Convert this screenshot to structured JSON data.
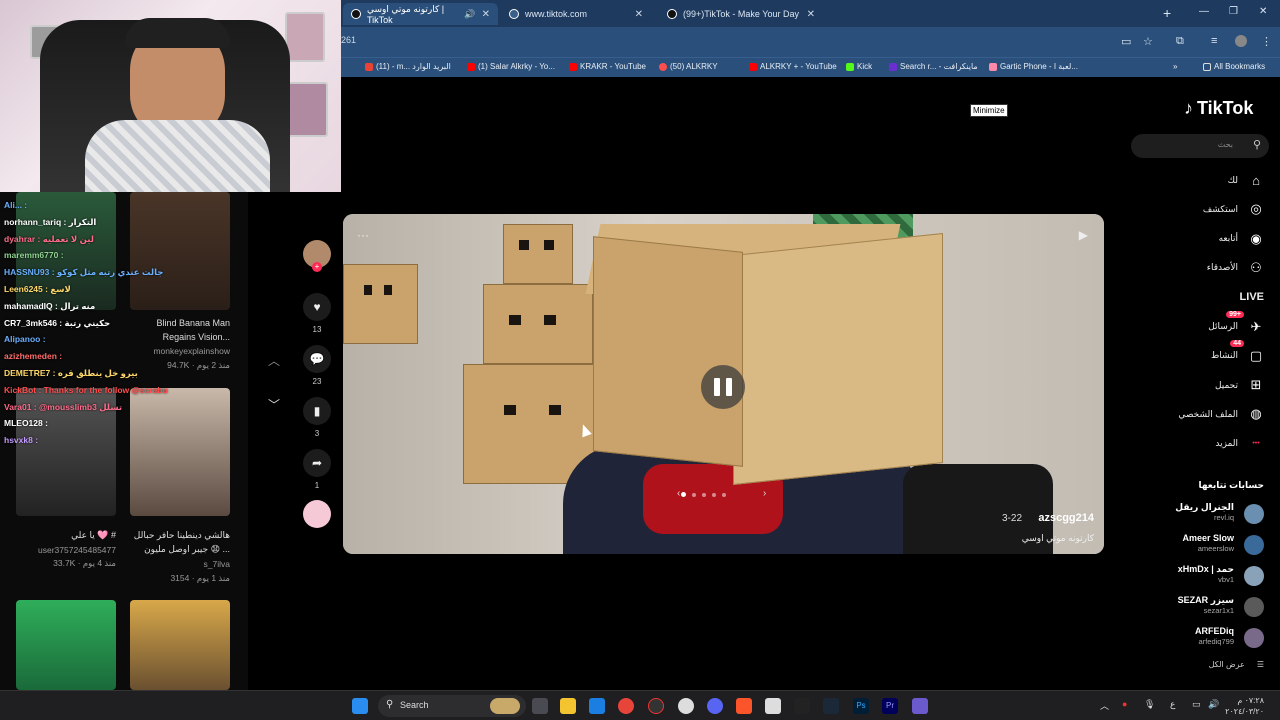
{
  "browser": {
    "tabs": [
      {
        "label": "كارتونه موتي اوسي | TikTok"
      },
      {
        "label": "www.tiktok.com"
      },
      {
        "label": "(99+)TikTok - Make Your Day"
      }
    ],
    "url_fragment": "261",
    "bookmarks": [
      "(11) - m... البريد الوارد",
      "(1) Salar Alkrky - Yo...",
      "KRAKR - YouTube",
      "(50) ALKRKY",
      "ALKRKY + - YouTube",
      "Kick",
      "Search r... - ماينكرافت",
      "Gartic Phone - لعبة ا...",
      "All Bookmarks"
    ],
    "tooltip": "Minimize"
  },
  "stream_chat": [
    {
      "text": "Ali... :",
      "color": "#6ab0ff"
    },
    {
      "text": "norhann_tariq : التكرار",
      "color": "#ffffff"
    },
    {
      "text": "dyahrar : لين لا تعمليه",
      "color": "#ff6b8a"
    },
    {
      "text": "maremm6770 :",
      "color": "#8fd18f"
    },
    {
      "text": "HASSNU93 : جالت عندي رتبه مثل كوكو",
      "color": "#6ab0ff"
    },
    {
      "text": "Leen6245 : لاسع",
      "color": "#ffd86b"
    },
    {
      "text": "mahamadIQ : منه ترال",
      "color": "#ffffff"
    },
    {
      "text": "CR7_3mk546 : حكيني رتبة",
      "color": "#ffffff"
    },
    {
      "text": "Alipanoo :",
      "color": "#6ab0ff"
    },
    {
      "text": "azizhemeden :",
      "color": "#ff6b6b"
    },
    {
      "text": "DEMETRE7 : بيرو خل ينطلق قره",
      "color": "#ffd86b"
    },
    {
      "text": "KickBot : Thanks for the follow @scrabu",
      "color": "#ff4d4d"
    },
    {
      "text": "Vara01 : @mousslimb3 تسلل",
      "color": "#ff6b8a"
    },
    {
      "text": "MLEO128 :",
      "color": "#ffffff"
    },
    {
      "text": "hsvxk8 :",
      "color": "#c59cff"
    }
  ],
  "feed_thumbs": [
    {
      "caption": "Blind Banana Man Regains Vision...",
      "author": "monkeyexplainshow",
      "stats": "94.7K · منذ 2 يوم"
    },
    {
      "caption": "يا علي 🩷 #",
      "author": "user3757245485477",
      "stats": "33.7K · منذ 4 يوم"
    },
    {
      "caption": "هالشي دينطينا حافر حبالل جيبر اوصل مليون 😧 ...",
      "author": "s_7ilva",
      "stats": "3154 · منذ 1 يوم"
    }
  ],
  "action_rail": {
    "likes": "13",
    "comments": "23",
    "saves": "3",
    "shares": "1"
  },
  "video": {
    "author": "azscgg214",
    "date": "3-22",
    "description": "كارتونه موتي اوسي"
  },
  "tiktok": {
    "logo": "TikTok",
    "search_placeholder": "بحث",
    "nav": [
      {
        "label": "لك",
        "icon": "home-icon"
      },
      {
        "label": "استكشف",
        "icon": "compass-icon"
      },
      {
        "label": "أتابعه",
        "icon": "following-icon"
      },
      {
        "label": "الأصدقاء",
        "icon": "friends-icon"
      },
      {
        "label": "LIVE",
        "icon": "live-icon"
      },
      {
        "label": "الرسائل",
        "icon": "messages-icon",
        "badge": "99+"
      },
      {
        "label": "النشاط",
        "icon": "activity-icon",
        "badge": "44"
      },
      {
        "label": "تحميل",
        "icon": "upload-icon"
      },
      {
        "label": "الملف الشخصي",
        "icon": "profile-icon"
      },
      {
        "label": "المزيد",
        "icon": "more-icon"
      }
    ],
    "following_header": "حسابات تتابعها",
    "following": [
      {
        "name": "الجنرال ريقل",
        "handle": "revl.iq"
      },
      {
        "name": "Ameer Slow",
        "handle": "ameerslow"
      },
      {
        "name": "xHmDx | حمد",
        "handle": "vbv1"
      },
      {
        "name": "SEZAR سيزر",
        "handle": "sezar1x1"
      },
      {
        "name": "ARFEDiq",
        "handle": "arfediq799"
      }
    ],
    "see_all": "عرض الكل"
  },
  "taskbar": {
    "search_label": "Search",
    "time": "٠٧:٢٨ م",
    "date": "٢٠٢٤/٠٣/٢٠",
    "lang": "ع"
  }
}
